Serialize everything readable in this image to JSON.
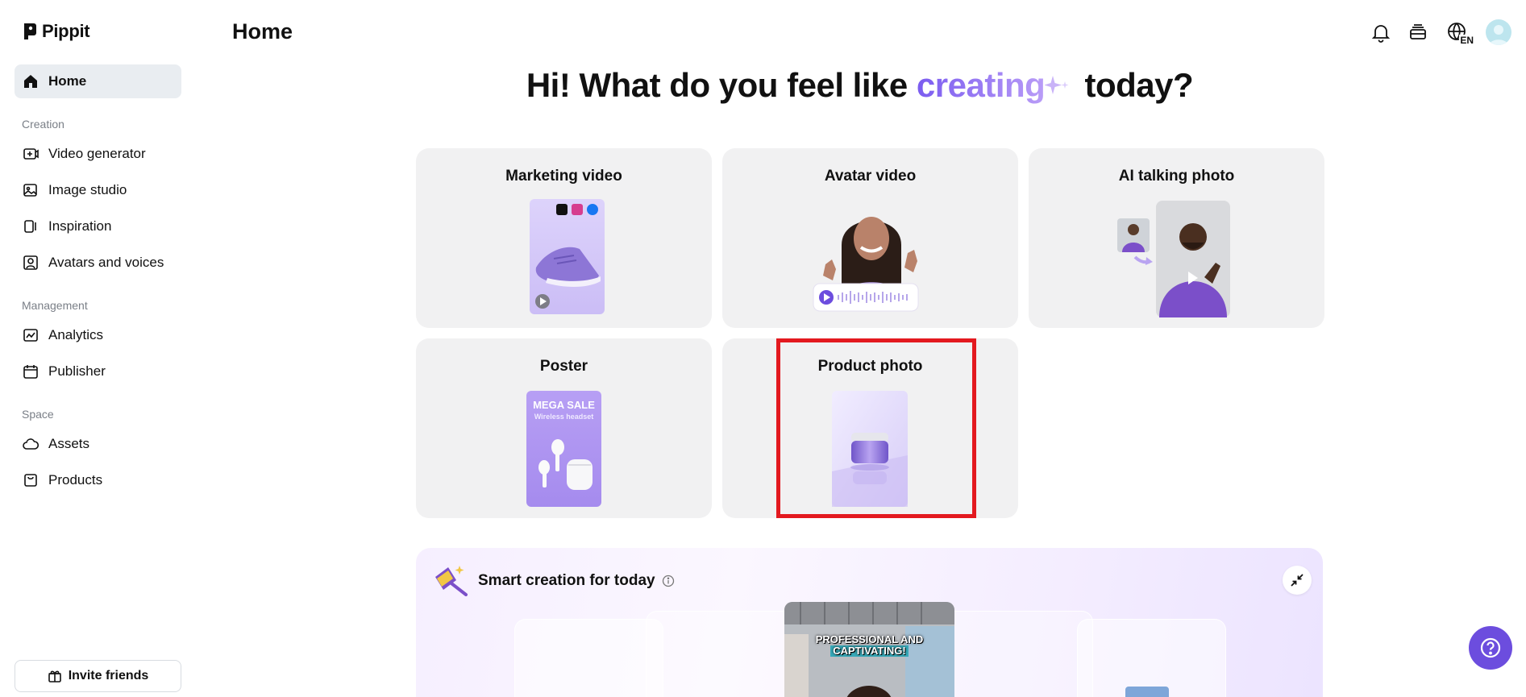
{
  "app": {
    "name": "Pippit"
  },
  "sidebar": {
    "home_label": "Home",
    "sections": {
      "creation": "Creation",
      "management": "Management",
      "space": "Space"
    },
    "items": {
      "video_generator": "Video generator",
      "image_studio": "Image studio",
      "inspiration": "Inspiration",
      "avatars_voices": "Avatars and voices",
      "analytics": "Analytics",
      "publisher": "Publisher",
      "assets": "Assets",
      "products": "Products"
    },
    "invite_label": "Invite friends"
  },
  "header": {
    "title": "Home",
    "language_badge": "EN",
    "icons": [
      "bell-icon",
      "layers-icon",
      "globe-icon",
      "avatar"
    ]
  },
  "hero": {
    "before": "Hi! What do you feel like ",
    "accent": "creating",
    "after": " today?"
  },
  "cards": {
    "marketing_video": "Marketing video",
    "avatar_video": "Avatar video",
    "ai_talking_photo": "AI talking photo",
    "poster": "Poster",
    "product_photo": "Product photo",
    "poster_art_title": "MEGA SALE",
    "poster_art_subtitle": "Wireless headset"
  },
  "smart_creation": {
    "title": "Smart creation for today",
    "video_caption_line1": "PROFESSIONAL AND",
    "video_caption_line2": "CAPTIVATING!"
  },
  "colors": {
    "accent": "#7b5cf0",
    "sidebar_active": "#e9edf1",
    "card_bg": "#f1f1f2",
    "highlight": "#e3191f",
    "help_button": "#6c4dde"
  }
}
